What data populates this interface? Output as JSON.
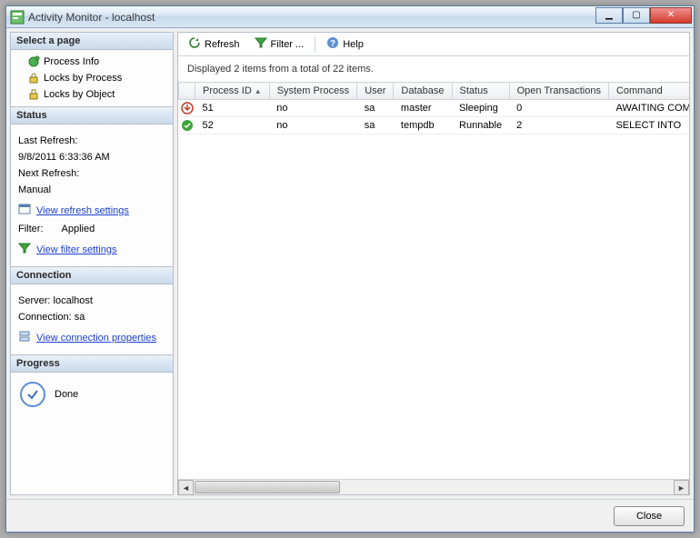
{
  "window": {
    "title": "Activity Monitor - localhost",
    "close_label": "✕",
    "min_label": "▁",
    "max_label": "▢"
  },
  "sidebar": {
    "select_header": "Select a page",
    "pages": [
      {
        "label": "Process Info"
      },
      {
        "label": "Locks by Process"
      },
      {
        "label": "Locks by Object"
      }
    ],
    "status": {
      "header": "Status",
      "last_refresh_label": "Last Refresh:",
      "last_refresh_value": "9/8/2011 6:33:36 AM",
      "next_refresh_label": "Next Refresh:",
      "next_refresh_value": "Manual",
      "refresh_link": "View refresh settings",
      "filter_label": "Filter:",
      "filter_value": "Applied",
      "filter_link": "View filter settings"
    },
    "connection": {
      "header": "Connection",
      "server_label": "Server: localhost",
      "conn_label": "Connection: sa",
      "props_link": "View connection properties"
    },
    "progress": {
      "header": "Progress",
      "state": "Done"
    }
  },
  "toolbar": {
    "refresh": "Refresh",
    "filter": "Filter ...",
    "help": "Help"
  },
  "summary": "Displayed 2 items from a total of 22 items.",
  "grid": {
    "columns": [
      "",
      "Process ID",
      "System Process",
      "User",
      "Database",
      "Status",
      "Open Transactions",
      "Command"
    ],
    "sort_col": "Process ID",
    "rows": [
      {
        "status_icon": "down",
        "process_id": "51",
        "system_process": "no",
        "user": "sa",
        "database": "master",
        "status": "Sleeping",
        "open_tx": "0",
        "command": "AWAITING COMMAND"
      },
      {
        "status_icon": "ok",
        "process_id": "52",
        "system_process": "no",
        "user": "sa",
        "database": "tempdb",
        "status": "Runnable",
        "open_tx": "2",
        "command": "SELECT INTO"
      }
    ]
  },
  "footer": {
    "close": "Close"
  }
}
